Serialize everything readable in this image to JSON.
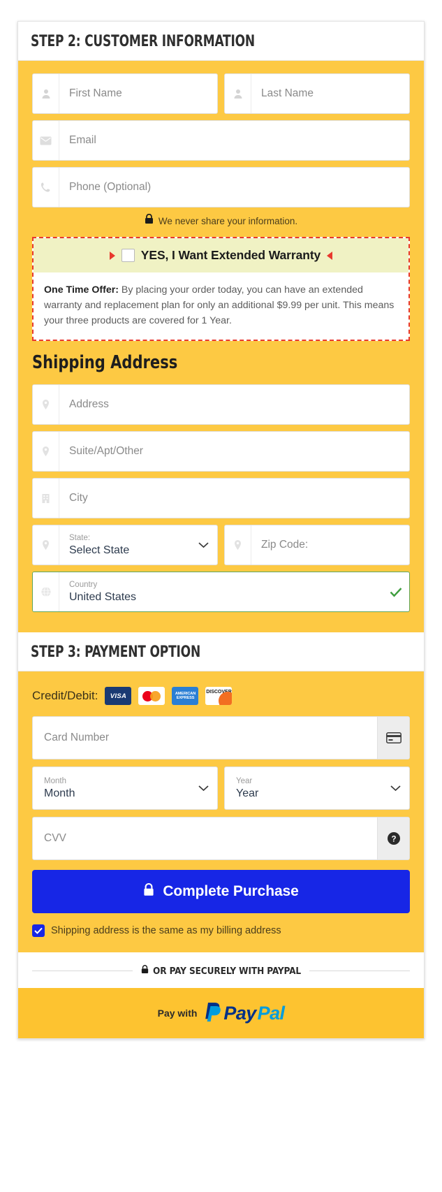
{
  "step2": {
    "heading": "STEP 2: CUSTOMER INFORMATION",
    "fields": {
      "first_name_placeholder": "First Name",
      "last_name_placeholder": "Last Name",
      "email_placeholder": "Email",
      "phone_placeholder": "Phone (Optional)"
    },
    "privacy_note": "We never share your information.",
    "privacy_icon": "lock-icon"
  },
  "offer": {
    "headline": "YES, I Want Extended Warranty",
    "checkbox_checked": false,
    "body_label": "One Time Offer:",
    "body_text": " By placing your order today, you can have an extended warranty and replacement plan for only an additional $9.99 per unit. This means your three products are covered for 1 Year.",
    "border_color": "#e8392e",
    "header_bg": "#f0f2c4"
  },
  "shipping": {
    "title": "Shipping Address",
    "address_placeholder": "Address",
    "suite_placeholder": "Suite/Apt/Other",
    "city_placeholder": "City",
    "state_label": "State:",
    "state_value": "Select State",
    "zip_placeholder": "Zip Code:",
    "country_label": "Country",
    "country_value": "United States",
    "country_valid": true,
    "valid_color": "#5fa75f"
  },
  "step3": {
    "heading": "STEP 3: PAYMENT OPTION",
    "credit_debit_label": "Credit/Debit:",
    "cards": [
      {
        "name": "visa-logo",
        "text": "VISA"
      },
      {
        "name": "mastercard-logo",
        "text": ""
      },
      {
        "name": "amex-logo",
        "text": "AMERICAN EXPRESS"
      },
      {
        "name": "discover-logo",
        "text": "DISCOVER"
      }
    ],
    "card_number_placeholder": "Card Number",
    "month_label": "Month",
    "month_value": "Month",
    "year_label": "Year",
    "year_value": "Year",
    "cvv_placeholder": "CVV",
    "buy_button": "Complete Purchase",
    "buy_button_color": "#1726e6",
    "same_address_label": "Shipping address is the same as my billing address",
    "same_address_checked": true
  },
  "paypal": {
    "divider_text": "OR PAY SECURELY WITH PAYPAL",
    "pay_with": "Pay with",
    "brand_part1": "Pay",
    "brand_part2": "Pal",
    "brand_color1": "#003087",
    "brand_color2": "#009cde",
    "button_bg": "#fdc330"
  },
  "theme": {
    "panel_yellow": "#fdc943"
  }
}
